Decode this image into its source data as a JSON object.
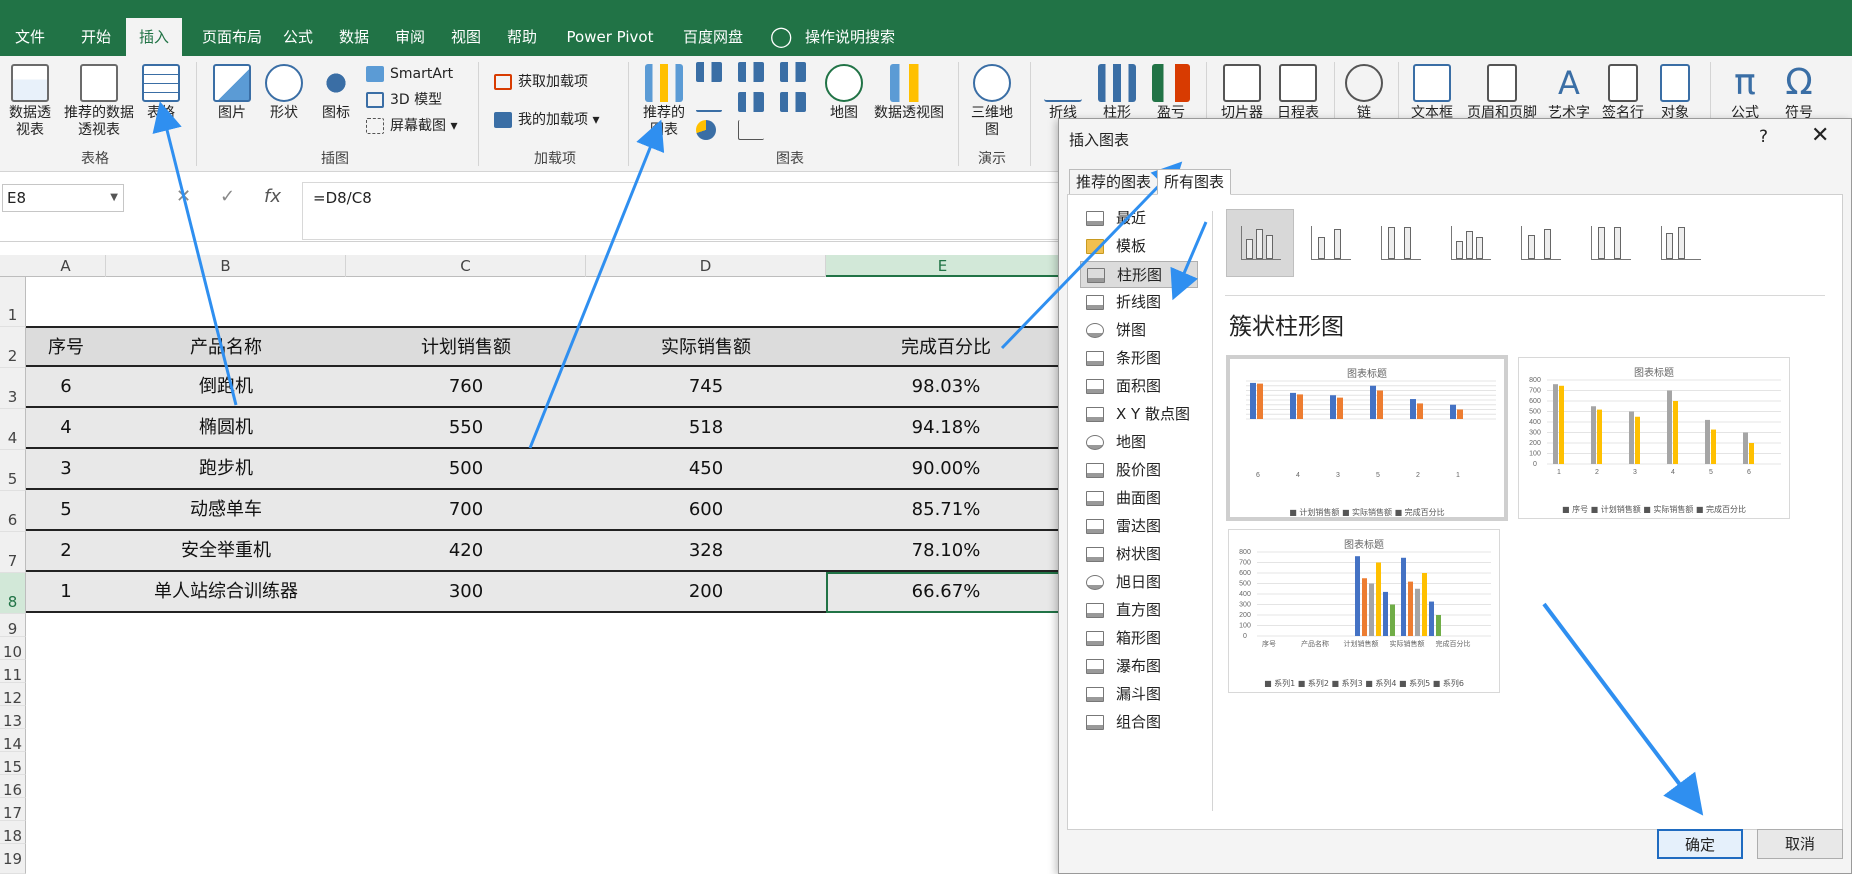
{
  "menu": {
    "tabs": [
      "文件",
      "开始",
      "插入",
      "页面布局",
      "公式",
      "数据",
      "审阅",
      "视图",
      "帮助",
      "Power Pivot",
      "百度网盘",
      "操作说明搜索"
    ],
    "active_tab": "插入"
  },
  "ribbon": {
    "pivot_table": "数据透视表",
    "recommended_pivot": "推荐的数据透视表",
    "table": "表格",
    "group_tables": "表格",
    "picture": "图片",
    "shapes": "形状",
    "icons": "图标",
    "smartart": "SmartArt",
    "model_3d": "3D 模型",
    "screenshot": "屏幕截图",
    "group_illustrations": "插图",
    "get_addins": "获取加载项",
    "my_addins": "我的加载项",
    "group_addins": "加载项",
    "recommended_charts": "推荐的图表",
    "map": "地图",
    "pivot_chart": "数据透视图",
    "group_charts": "图表",
    "map_3d": "三维地图",
    "group_tours": "演示",
    "sparkline_line": "折线",
    "sparkline_column": "柱形",
    "sparkline_winloss": "盈亏",
    "slicer": "切片器",
    "timeline": "日程表",
    "link": "链",
    "textbox": "文本框",
    "header_footer": "页眉和页脚",
    "wordart": "艺术字",
    "signature": "签名行",
    "object": "对象",
    "equation": "公式",
    "symbol": "符号"
  },
  "formula_bar": {
    "name_box": "E8",
    "cancel": "✕",
    "enter": "✓",
    "fx": "fx",
    "formula": "=D8/C8"
  },
  "sheet": {
    "columns": [
      "A",
      "B",
      "C",
      "D",
      "E"
    ],
    "row_numbers": [
      "1",
      "2",
      "3",
      "4",
      "5",
      "6",
      "7",
      "8",
      "9",
      "10",
      "11",
      "12",
      "13",
      "14",
      "15",
      "16",
      "17",
      "18",
      "19"
    ],
    "headers": [
      "序号",
      "产品名称",
      "计划销售额",
      "实际销售额",
      "完成百分比"
    ],
    "rows": [
      [
        "6",
        "倒跑机",
        "760",
        "745",
        "98.03%"
      ],
      [
        "4",
        "椭圆机",
        "550",
        "518",
        "94.18%"
      ],
      [
        "3",
        "跑步机",
        "500",
        "450",
        "90.00%"
      ],
      [
        "5",
        "动感单车",
        "700",
        "600",
        "85.71%"
      ],
      [
        "2",
        "安全举重机",
        "420",
        "328",
        "78.10%"
      ],
      [
        "1",
        "单人站综合训练器",
        "300",
        "200",
        "66.67%"
      ]
    ]
  },
  "dialog": {
    "title": "插入图表",
    "help": "?",
    "close": "✕",
    "tabs": [
      "推荐的图表",
      "所有图表"
    ],
    "active_tab": "所有图表",
    "chart_types": [
      "最近",
      "模板",
      "柱形图",
      "折线图",
      "饼图",
      "条形图",
      "面积图",
      "X Y 散点图",
      "地图",
      "股价图",
      "曲面图",
      "雷达图",
      "树状图",
      "旭日图",
      "直方图",
      "箱形图",
      "瀑布图",
      "漏斗图",
      "组合图"
    ],
    "selected_type": "柱形图",
    "variant_title": "簇状柱形图",
    "preview_title": "图表标题",
    "preview1_legend": "■ 计划销售额 ■ 实际销售额 ■ 完成百分比",
    "preview2_legend": "■ 序号 ■ 计划销售额 ■ 实际销售额 ■ 完成百分比",
    "preview3_legend": "■ 系列1 ■ 系列2 ■ 系列3 ■ 系列4 ■ 系列5 ■ 系列6",
    "preview3_categories": [
      "序号",
      "产品名称",
      "计划销售额",
      "实际销售额",
      "完成百分比"
    ],
    "preview1_categories": [
      "6",
      "4",
      "3",
      "5",
      "2",
      "1"
    ],
    "preview2_categories": [
      "1",
      "2",
      "3",
      "4",
      "5",
      "6"
    ],
    "preview_yticks": [
      "800",
      "700",
      "600",
      "500",
      "400",
      "300",
      "200",
      "100",
      "0"
    ],
    "ok": "确定",
    "cancel": "取消"
  },
  "colors": {
    "excel_green": "#217346",
    "series_blue": "#4472c4",
    "series_orange": "#ed7d31",
    "series_gray": "#a5a5a5",
    "series_yellow": "#ffc000",
    "annotation_arrow": "#2f8ff0"
  }
}
